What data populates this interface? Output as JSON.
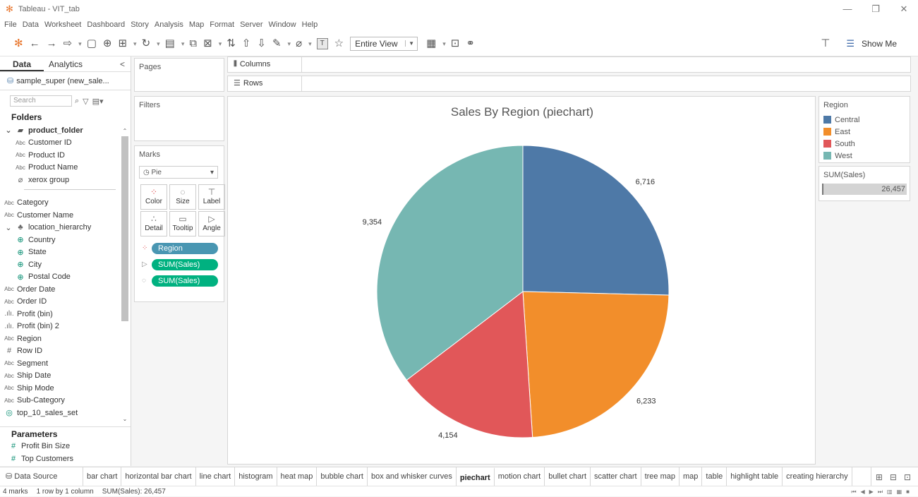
{
  "window": {
    "title": "Tableau - VIT_tab",
    "minimize": "—",
    "maximize": "❐",
    "close": "✕"
  },
  "menu": [
    "File",
    "Data",
    "Worksheet",
    "Dashboard",
    "Story",
    "Analysis",
    "Map",
    "Format",
    "Server",
    "Window",
    "Help"
  ],
  "toolbar": {
    "view_select": "Entire View",
    "show_me": "Show Me"
  },
  "left_pane": {
    "tabs": {
      "data": "Data",
      "analytics": "Analytics",
      "collapse": "<"
    },
    "datasource": "sample_super (new_sale...",
    "search_placeholder": "Search",
    "folders_title": "Folders",
    "product_folder": {
      "name": "product_folder",
      "items": [
        {
          "type": "Abc",
          "name": "Customer ID"
        },
        {
          "type": "Abc",
          "name": "Product ID"
        },
        {
          "type": "Abc",
          "name": "Product Name"
        },
        {
          "type": "group",
          "name": "xerox group"
        }
      ]
    },
    "fields_top": [
      {
        "type": "Abc",
        "name": "Category"
      },
      {
        "type": "Abc",
        "name": "Customer Name"
      }
    ],
    "hierarchy": {
      "name": "location_hierarchy",
      "items": [
        "Country",
        "State",
        "City",
        "Postal Code"
      ]
    },
    "fields_bottom": [
      {
        "type": "Abc",
        "name": "Order Date"
      },
      {
        "type": "Abc",
        "name": "Order ID"
      },
      {
        "type": "bin",
        "name": "Profit (bin)"
      },
      {
        "type": "bin",
        "name": "Profit (bin) 2"
      },
      {
        "type": "Abc",
        "name": "Region"
      },
      {
        "type": "#",
        "name": "Row ID"
      },
      {
        "type": "Abc",
        "name": "Segment"
      },
      {
        "type": "Abc",
        "name": "Ship Date"
      },
      {
        "type": "Abc",
        "name": "Ship Mode"
      },
      {
        "type": "Abc",
        "name": "Sub-Category"
      },
      {
        "type": "set",
        "name": "top_10_sales_set"
      }
    ],
    "parameters_title": "Parameters",
    "parameters": [
      "Profit Bin Size",
      "Top Customers"
    ]
  },
  "cards": {
    "pages": "Pages",
    "filters": "Filters",
    "marks": "Marks",
    "mark_type": "Pie",
    "mark_buttons": [
      "Color",
      "Size",
      "Label",
      "Detail",
      "Tooltip",
      "Angle"
    ],
    "pills": [
      "Region",
      "SUM(Sales)",
      "SUM(Sales)"
    ]
  },
  "shelves": {
    "columns": "Columns",
    "rows": "Rows"
  },
  "sheet_title": "Sales By Region (piechart)",
  "legend": {
    "title": "Region",
    "items": [
      {
        "name": "Central",
        "color": "#4e79a7"
      },
      {
        "name": "East",
        "color": "#f28e2b"
      },
      {
        "name": "South",
        "color": "#e15759"
      },
      {
        "name": "West",
        "color": "#76b7b2"
      }
    ]
  },
  "size_legend": {
    "title": "SUM(Sales)",
    "value": "26,457"
  },
  "chart_data": {
    "type": "pie",
    "title": "Sales By Region (piechart)",
    "categories": [
      "Central",
      "East",
      "South",
      "West"
    ],
    "values": [
      6716,
      6233,
      4154,
      9354
    ],
    "labels": [
      "6,716",
      "6,233",
      "4,154",
      "9,354"
    ],
    "colors": [
      "#4e79a7",
      "#f28e2b",
      "#e15759",
      "#76b7b2"
    ],
    "legend": "top-right"
  },
  "tabs": {
    "data_source": "Data Source",
    "sheets": [
      "bar chart",
      "horizontal bar chart",
      "line chart",
      "histogram",
      "heat map",
      "bubble chart",
      "box and whisker curves",
      "piechart",
      "motion chart",
      "bullet chart",
      "scatter chart",
      "tree map",
      "map",
      "table",
      "highlight table",
      "creating hierarchy"
    ],
    "active": "piechart"
  },
  "status": {
    "marks": "4 marks",
    "layout": "1 row by 1 column",
    "sum": "SUM(Sales): 26,457"
  }
}
